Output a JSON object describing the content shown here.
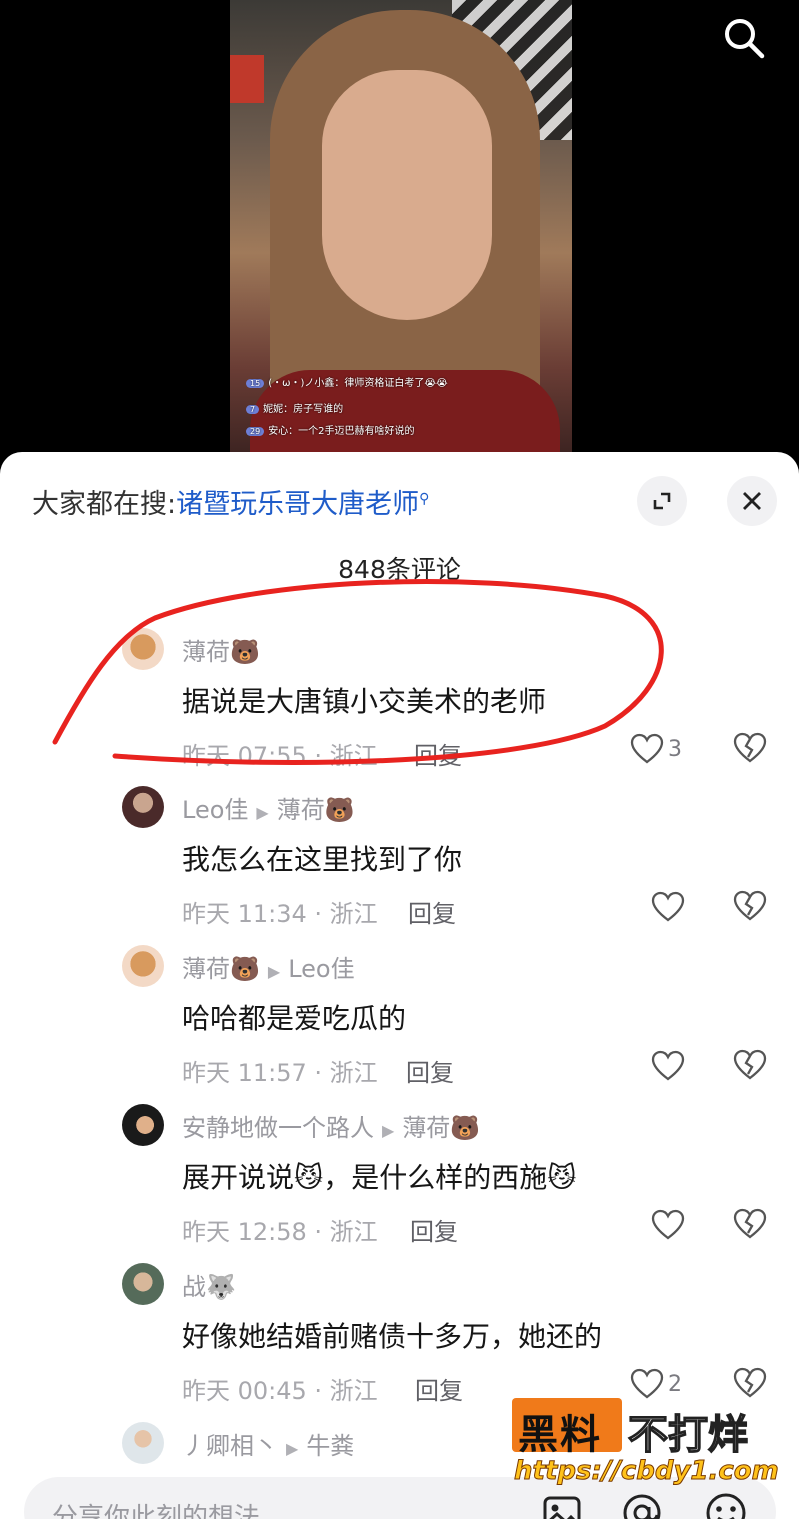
{
  "live_stream": {
    "messages": [
      {
        "level": "15",
        "text": "(・ω・)ノ小鑫：律师资格证白考了😭😭"
      },
      {
        "level": "7",
        "text": "妮妮：房子写谁的"
      },
      {
        "level": "29",
        "text": "安心：一个2手迈巴赫有啥好说的"
      }
    ]
  },
  "header": {
    "hot_search_prefix": "大家都在搜:",
    "hot_search_term": "诸暨玩乐哥大唐老师",
    "comment_count": "848条评论"
  },
  "comments": [
    {
      "username": "薄荷🐻",
      "reply_to": "",
      "text": "据说是大唐镇小交美术的老师",
      "meta": "昨天 07:55 · 浙江",
      "reply": "回复",
      "likes": "3"
    },
    {
      "username": "Leo佳",
      "reply_to": "薄荷🐻",
      "text": "我怎么在这里找到了你",
      "meta": "昨天 11:34 · 浙江",
      "reply": "回复",
      "likes": ""
    },
    {
      "username": "薄荷🐻",
      "reply_to": "Leo佳",
      "text": "哈哈都是爱吃瓜的",
      "meta": "昨天 11:57 · 浙江",
      "reply": "回复",
      "likes": ""
    },
    {
      "username": "安静地做一个路人",
      "reply_to": "薄荷🐻",
      "text": "展开说说😼，是什么样的西施😼",
      "meta": "昨天 12:58 · 浙江",
      "reply": "回复",
      "likes": ""
    },
    {
      "username": "战🐺",
      "reply_to": "",
      "text": "好像她结婚前赌债十多万，她还的",
      "meta": "昨天 00:45 · 浙江",
      "reply": "回复",
      "likes": "2"
    },
    {
      "username": "丿卿相丶",
      "reply_to": "牛粪",
      "text": "",
      "meta": "",
      "reply": "",
      "likes": ""
    }
  ],
  "input": {
    "placeholder": "分享你此刻的想法"
  },
  "watermark": {
    "left": "黑料",
    "right": "不打烊",
    "url": "https://cbdy1.com"
  },
  "colors": {
    "accent_blue": "#1f5cc9",
    "annotation_red": "#e8231f",
    "watermark_orange": "#f07a1a"
  }
}
